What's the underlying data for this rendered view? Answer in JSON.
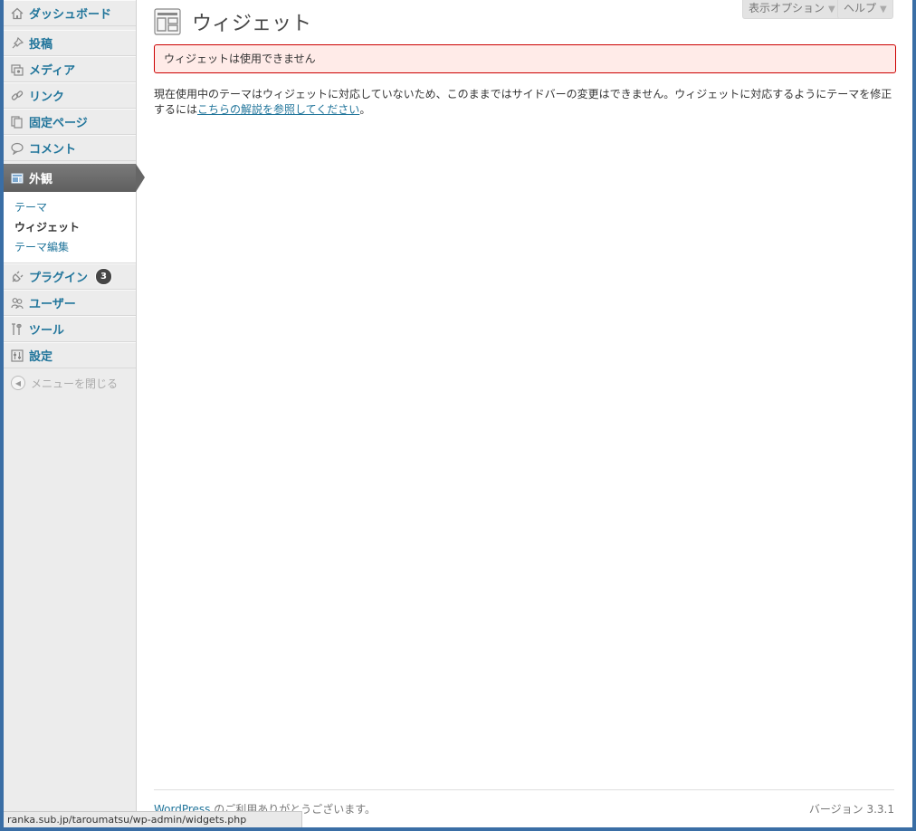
{
  "sidebar": {
    "items": [
      {
        "label": "ダッシュボード",
        "icon": "home-icon"
      },
      {
        "label": "投稿",
        "icon": "pin-icon"
      },
      {
        "label": "メディア",
        "icon": "media-icon"
      },
      {
        "label": "リンク",
        "icon": "link-icon"
      },
      {
        "label": "固定ページ",
        "icon": "pages-icon"
      },
      {
        "label": "コメント",
        "icon": "comment-icon"
      },
      {
        "label": "外観",
        "icon": "appearance-icon"
      },
      {
        "label": "プラグイン",
        "icon": "plug-icon",
        "badge": "3"
      },
      {
        "label": "ユーザー",
        "icon": "users-icon"
      },
      {
        "label": "ツール",
        "icon": "tools-icon"
      },
      {
        "label": "設定",
        "icon": "settings-icon"
      }
    ],
    "submenu": [
      "テーマ",
      "ウィジェット",
      "テーマ編集"
    ],
    "collapse_label": "メニューを閉じる"
  },
  "header": {
    "title": "ウィジェット",
    "screen_options": "表示オプション",
    "help": "ヘルプ"
  },
  "error": "ウィジェットは使用できません",
  "notice": {
    "text": "現在使用中のテーマはウィジェットに対応していないため、このままではサイドバーの変更はできません。ウィジェットに対応するようにテーマを修正するには",
    "link": "こちらの解説を参照してください",
    "end": "。"
  },
  "footer": {
    "link": "WordPress",
    "text": " のご利用ありがとうございます。",
    "version": "バージョン 3.3.1"
  },
  "statusbar": "ranka.sub.jp/taroumatsu/wp-admin/widgets.php",
  "colors": {
    "link": "#21759b",
    "error_bg": "#ffebe8",
    "error_border": "#cc0000",
    "current_menu": "#6d6d6d"
  }
}
